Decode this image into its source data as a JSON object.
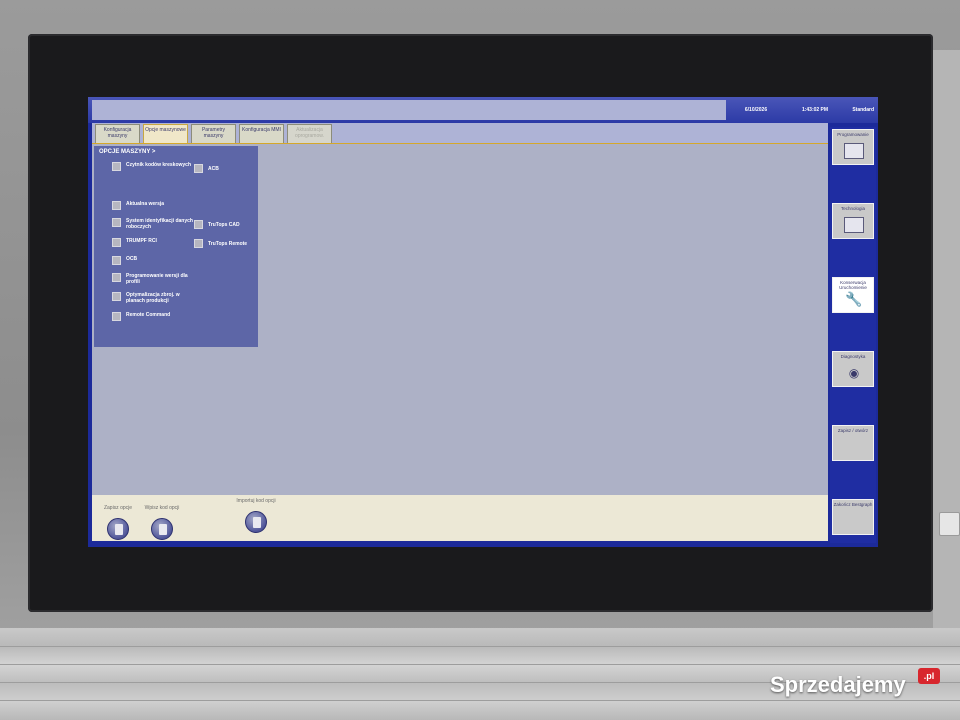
{
  "topbar": {
    "date": "6/10/2026",
    "time": "1:43:02 PM",
    "mode": "Standard"
  },
  "tabs": [
    {
      "label": "Konfiguracja maszyny",
      "state": "normal"
    },
    {
      "label": "Opcje maszynowe",
      "state": "active"
    },
    {
      "label": "Parametry maszyny",
      "state": "normal"
    },
    {
      "label": "Konfiguracja MMI",
      "state": "normal"
    },
    {
      "label": "Aktualizacja oprogramow.",
      "state": "disabled"
    }
  ],
  "options_panel": {
    "title": "OPCJE MASZYNY >",
    "left": [
      "Czytnik kodów kreskowych",
      "Aktualna wersja",
      "System identyfikacji danych roboczych",
      "TRUMPF RCI",
      "OCB",
      "Programowanie wersji dla profili",
      "Optymalizacja zbroj. w planach produkcji",
      "Remote Command"
    ],
    "right": [
      "ACB",
      "TruTops CAD",
      "TruTops Remote"
    ]
  },
  "bottom_actions": [
    {
      "label": "Zapisz opcje",
      "icon": "document-icon"
    },
    {
      "label": "Wpisz kod opcji",
      "icon": "keyboard-icon"
    },
    {
      "label": "Importuj kod opcji",
      "icon": "folder-import-icon"
    }
  ],
  "right_menu": [
    {
      "label": "Programowanie",
      "icon": "programming-icon"
    },
    {
      "label": "Technologia",
      "icon": "table-icon"
    },
    {
      "label": "Konserwacja Uruchomienie",
      "icon": "wrench-icon"
    },
    {
      "label": "Diagnostyka",
      "icon": "eye-icon"
    },
    {
      "label": "Zapisz / otwórz",
      "icon": ""
    },
    {
      "label": "Zakończ Bestgraph",
      "icon": ""
    }
  ],
  "watermark": {
    "text": "Sprzedajemy",
    "suffix": ".pl"
  },
  "colors": {
    "screen_blue": "#1c2a9a",
    "panel_blue": "#5d66a7",
    "active_tab_gold": "#d5a82a",
    "content_gray": "#adb1c6"
  }
}
